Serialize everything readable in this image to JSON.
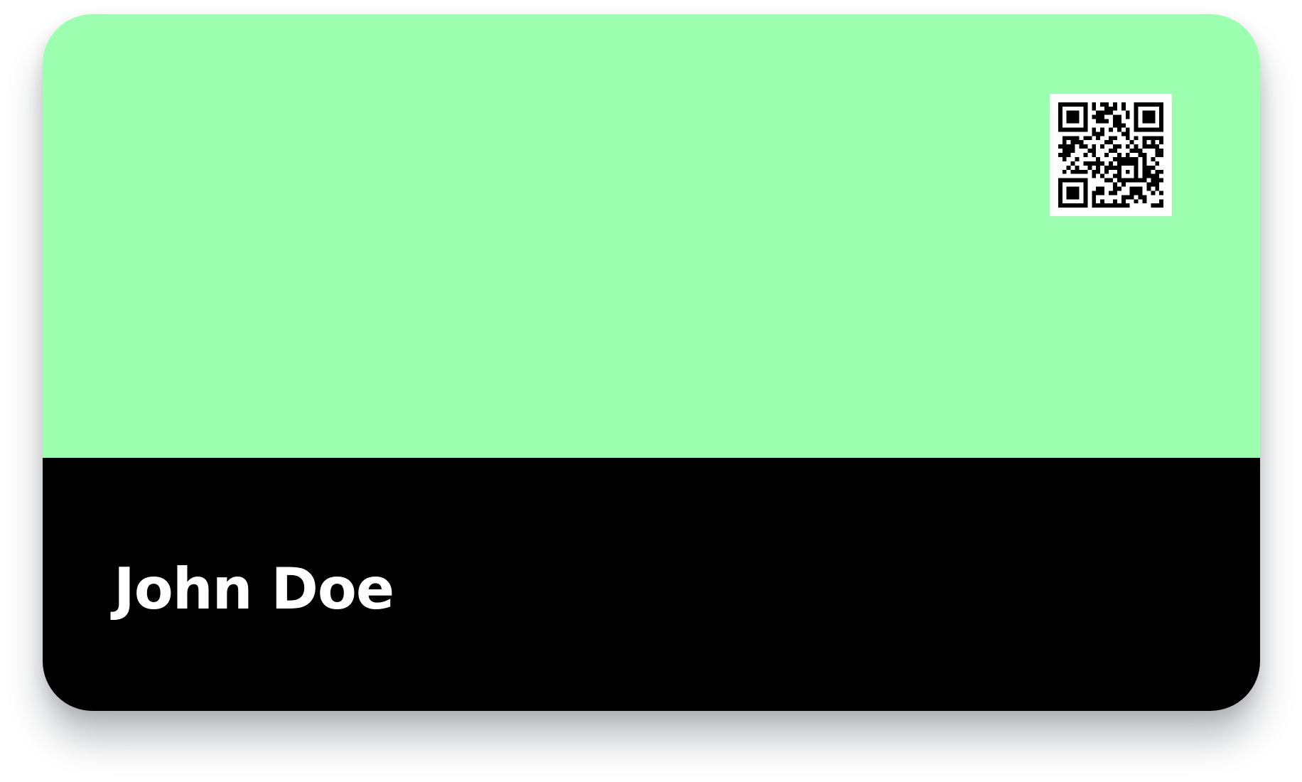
{
  "card": {
    "holder_name": "John Doe",
    "top_color": "#9BFFAF",
    "bottom_color": "#000000",
    "name_color": "#FFFFFF"
  },
  "qr": {
    "icon": "qr-code-icon",
    "foreground": "#000000",
    "background": "#FFFFFF"
  }
}
